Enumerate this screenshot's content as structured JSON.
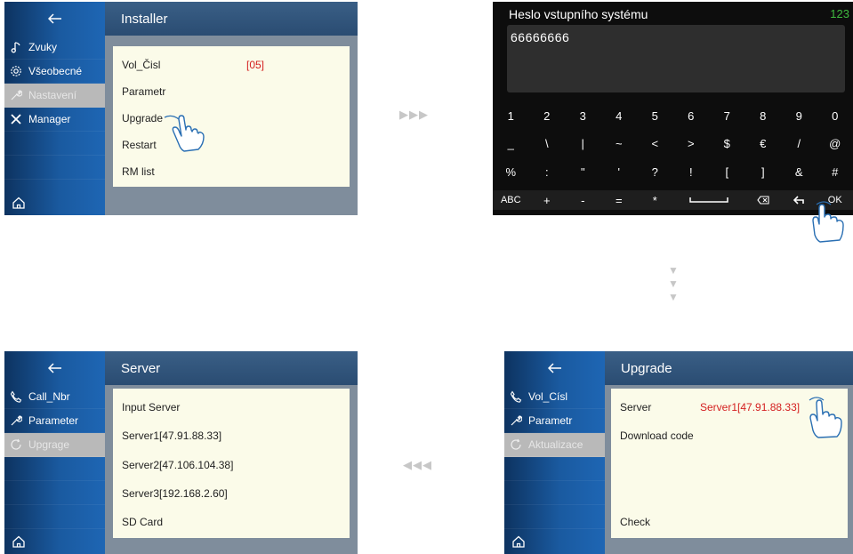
{
  "panel1": {
    "header_title": "Installer",
    "sidebar": [
      {
        "label": "Zvuky",
        "icon": "music-note-icon"
      },
      {
        "label": "Všeobecné",
        "icon": "gear-icon"
      },
      {
        "label": "Nastavení",
        "icon": "wrench-icon",
        "active": true
      },
      {
        "label": "Manager",
        "icon": "tools-icon"
      }
    ],
    "items": [
      {
        "label": "Vol_Čisl",
        "value": "[05]"
      },
      {
        "label": "Parametr"
      },
      {
        "label": "Upgrade"
      },
      {
        "label": "Restart"
      },
      {
        "label": "RM list"
      }
    ]
  },
  "keyboard": {
    "title": "Heslo vstupního systému",
    "mode": "123",
    "input_value": "66666666",
    "rows": [
      [
        "1",
        "2",
        "3",
        "4",
        "5",
        "6",
        "7",
        "8",
        "9",
        "0"
      ],
      [
        "_",
        "\\",
        "|",
        "~",
        "<",
        ">",
        "$",
        "€",
        "/",
        "@"
      ],
      [
        "%",
        ":",
        "\"",
        "'",
        "?",
        "!",
        "[",
        "]",
        "&",
        "#"
      ],
      [
        "ABC",
        "+",
        "-",
        "=",
        "*",
        "space",
        "backspace",
        "return",
        "OK"
      ]
    ]
  },
  "panel3": {
    "header_title": "Server",
    "sidebar": [
      {
        "label": "Call_Nbr",
        "icon": "phone-icon"
      },
      {
        "label": "Parameter",
        "icon": "wrench-icon"
      },
      {
        "label": "Upgrage",
        "icon": "refresh-icon",
        "active": true
      }
    ],
    "items": [
      {
        "label": "Input Server"
      },
      {
        "label": "Server1[47.91.88.33]"
      },
      {
        "label": "Server2[47.106.104.38]"
      },
      {
        "label": "Server3[192.168.2.60]"
      },
      {
        "label": "SD Card"
      }
    ]
  },
  "panel4": {
    "header_title": "Upgrade",
    "sidebar": [
      {
        "label": "Vol_Císl",
        "icon": "phone-icon"
      },
      {
        "label": "Parametr",
        "icon": "wrench-icon"
      },
      {
        "label": "Aktualizace",
        "icon": "refresh-icon",
        "active": true
      }
    ],
    "items": [
      {
        "label": "Server",
        "value": "Server1[47.91.88.33]"
      },
      {
        "label": "Download code"
      },
      {
        "label": "Check"
      }
    ]
  },
  "arrows": {
    "right": "▶▶▶",
    "down": "▼",
    "left": "◀◀◀"
  },
  "colors": {
    "sidebar": "#1a5aa0",
    "header": "#2f5378",
    "card": "#fbfbe9",
    "accent_red": "#d42020",
    "mode_green": "#3fb93f"
  }
}
